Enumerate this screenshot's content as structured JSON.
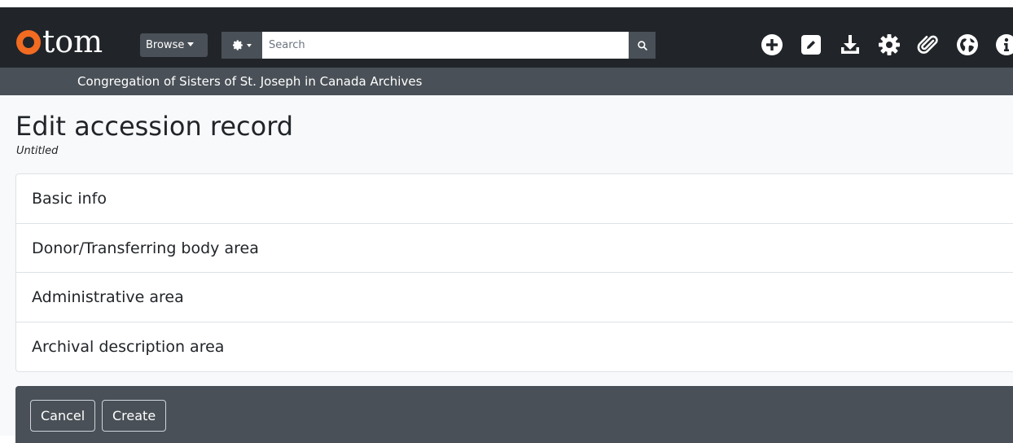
{
  "header": {
    "logo_text": "tom",
    "browse_label": "Browse",
    "search": {
      "placeholder": "Search",
      "value": ""
    },
    "icons": [
      "plus-circle-icon",
      "edit-icon",
      "download-icon",
      "gear-icon",
      "paperclip-icon",
      "globe-icon",
      "info-icon"
    ]
  },
  "repository": {
    "name": "Congregation of Sisters of St. Joseph in Canada Archives"
  },
  "page": {
    "title": "Edit accession record",
    "subtitle": "Untitled"
  },
  "sections": [
    {
      "label": "Basic info"
    },
    {
      "label": "Donor/Transferring body area"
    },
    {
      "label": "Administrative area"
    },
    {
      "label": "Archival description area"
    }
  ],
  "actions": {
    "cancel_label": "Cancel",
    "create_label": "Create"
  },
  "colors": {
    "brand_orange": "#f26b21",
    "topbar": "#212529",
    "secondary_bar": "#495057"
  }
}
